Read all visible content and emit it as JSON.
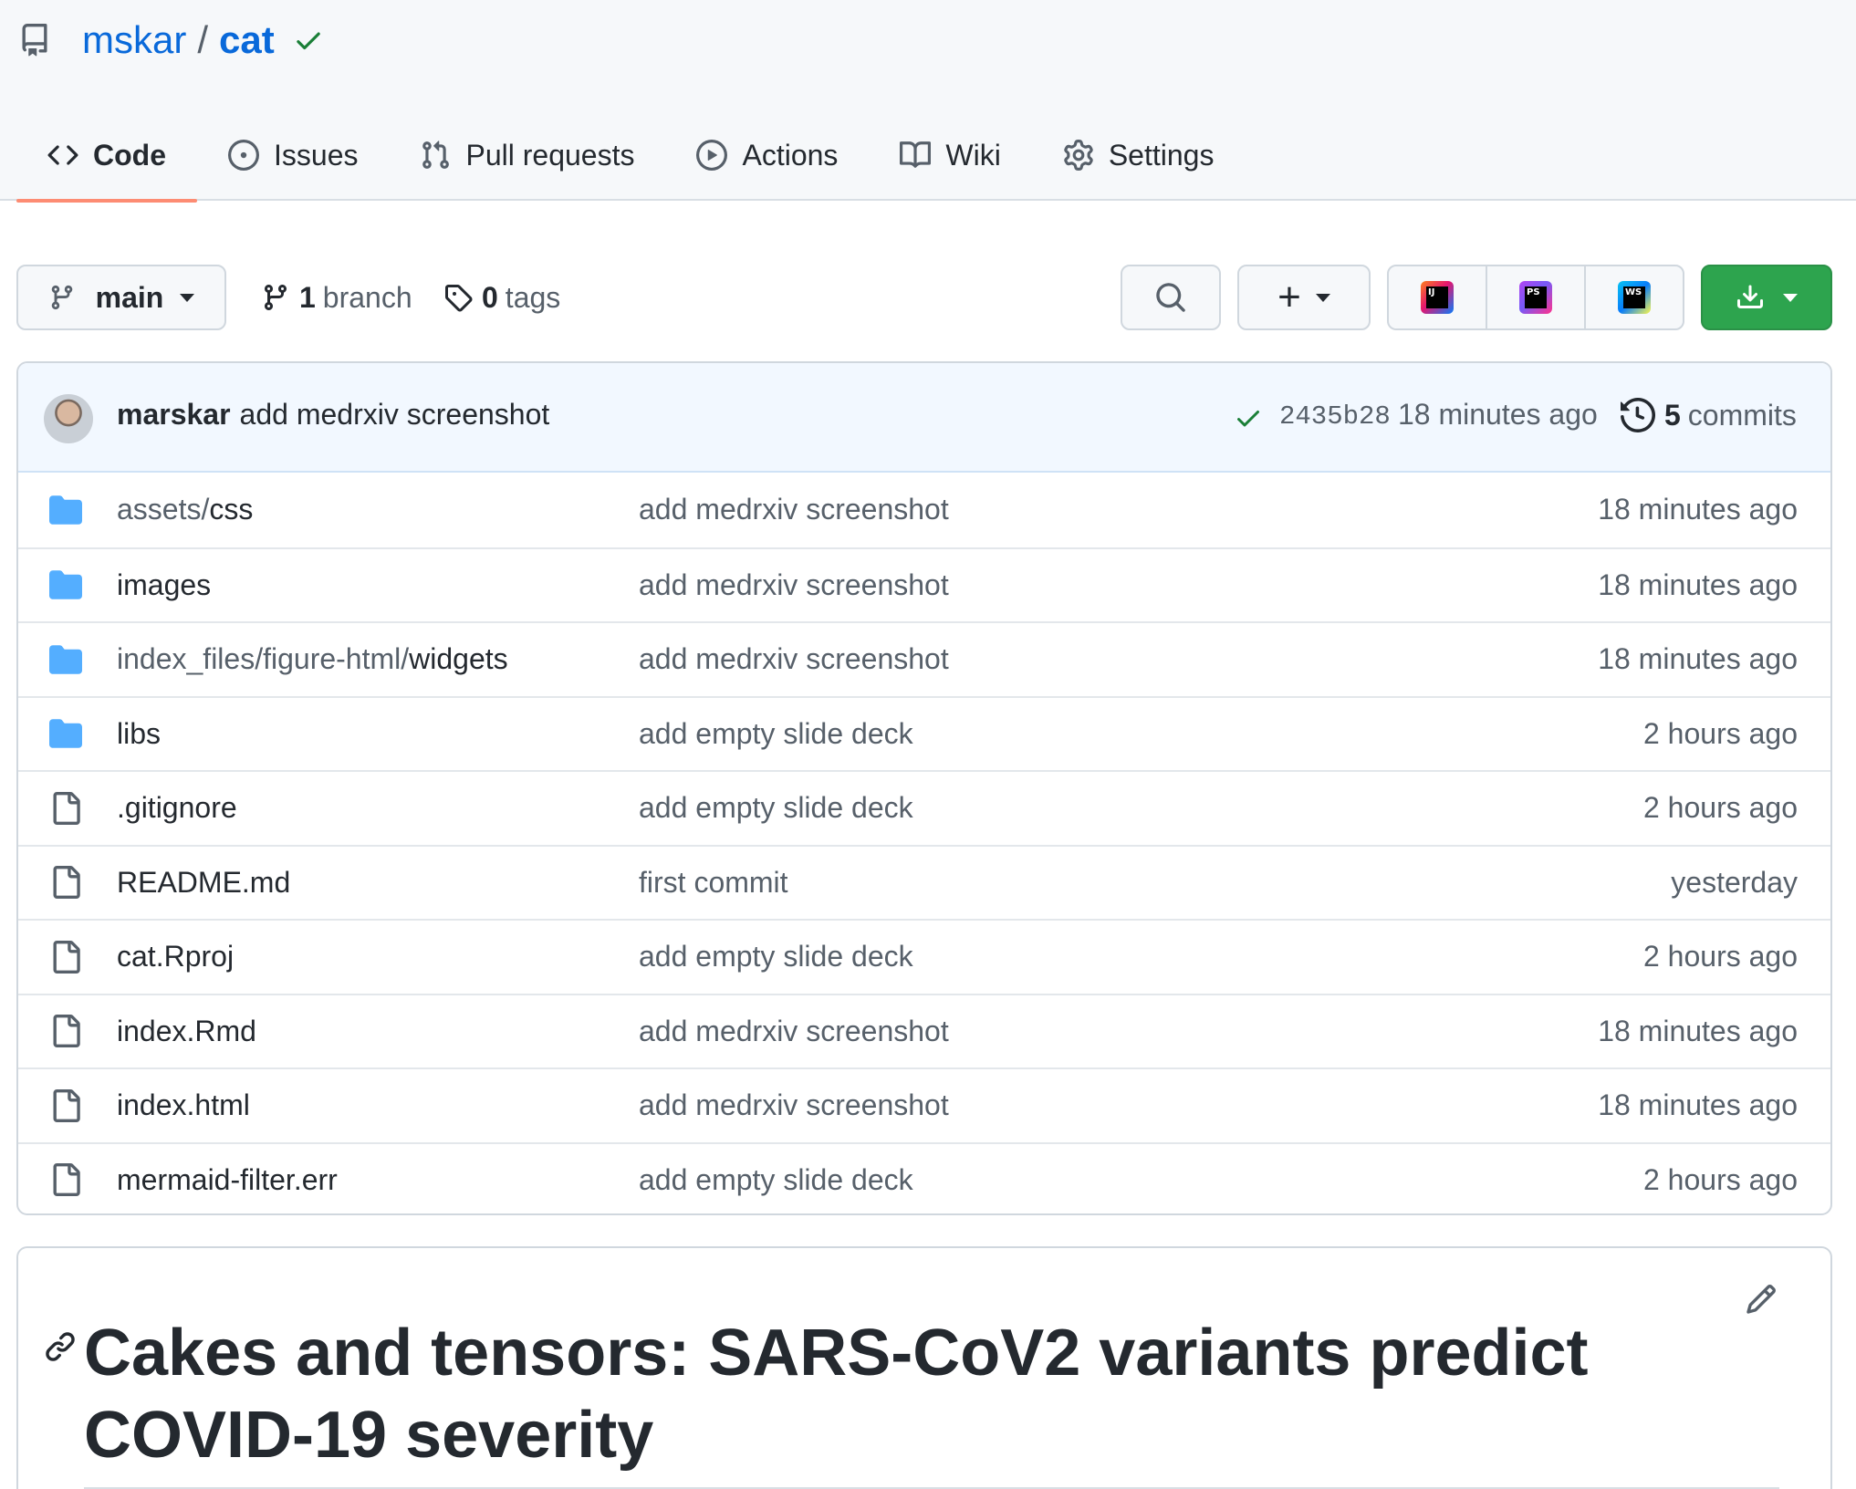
{
  "repo": {
    "owner": "mskar",
    "separator": "/",
    "name": "cat"
  },
  "tabs": [
    {
      "label": "Code",
      "icon": "code-icon",
      "selected": true
    },
    {
      "label": "Issues",
      "icon": "issue-icon"
    },
    {
      "label": "Pull requests",
      "icon": "pull-request-icon"
    },
    {
      "label": "Actions",
      "icon": "play-icon"
    },
    {
      "label": "Wiki",
      "icon": "book-icon"
    },
    {
      "label": "Settings",
      "icon": "gear-icon"
    }
  ],
  "toolbar": {
    "branch": "main",
    "branch_count": "1",
    "branch_label": "branch",
    "tag_count": "0",
    "tag_label": "tags",
    "add_label": "+",
    "ide_labels": [
      "IJ",
      "PS",
      "WS"
    ]
  },
  "commit": {
    "author": "marskar",
    "message": "add medrxiv screenshot",
    "sha": "2435b28",
    "time": "18 minutes ago",
    "count": "5",
    "count_label": "commits"
  },
  "files": [
    {
      "type": "dir",
      "dir": "assets/",
      "name": "css",
      "message": "add medrxiv screenshot",
      "age": "18 minutes ago"
    },
    {
      "type": "dir",
      "dir": "",
      "name": "images",
      "message": "add medrxiv screenshot",
      "age": "18 minutes ago"
    },
    {
      "type": "dir",
      "dir": "index_files/figure-html/",
      "name": "widgets",
      "message": "add medrxiv screenshot",
      "age": "18 minutes ago"
    },
    {
      "type": "dir",
      "dir": "",
      "name": "libs",
      "message": "add empty slide deck",
      "age": "2 hours ago"
    },
    {
      "type": "file",
      "dir": "",
      "name": ".gitignore",
      "message": "add empty slide deck",
      "age": "2 hours ago"
    },
    {
      "type": "file",
      "dir": "",
      "name": "README.md",
      "message": "first commit",
      "age": "yesterday"
    },
    {
      "type": "file",
      "dir": "",
      "name": "cat.Rproj",
      "message": "add empty slide deck",
      "age": "2 hours ago"
    },
    {
      "type": "file",
      "dir": "",
      "name": "index.Rmd",
      "message": "add medrxiv screenshot",
      "age": "18 minutes ago"
    },
    {
      "type": "file",
      "dir": "",
      "name": "index.html",
      "message": "add medrxiv screenshot",
      "age": "18 minutes ago"
    },
    {
      "type": "file",
      "dir": "",
      "name": "mermaid-filter.err",
      "message": "add empty slide deck",
      "age": "2 hours ago"
    }
  ],
  "readme": {
    "title": "Cakes and tensors: SARS-CoV2 variants predict COVID-19 severity"
  },
  "colors": {
    "link": "#0969da",
    "success": "#2da44e",
    "folder": "#54aeff",
    "tab_underline": "#fd8c73"
  }
}
